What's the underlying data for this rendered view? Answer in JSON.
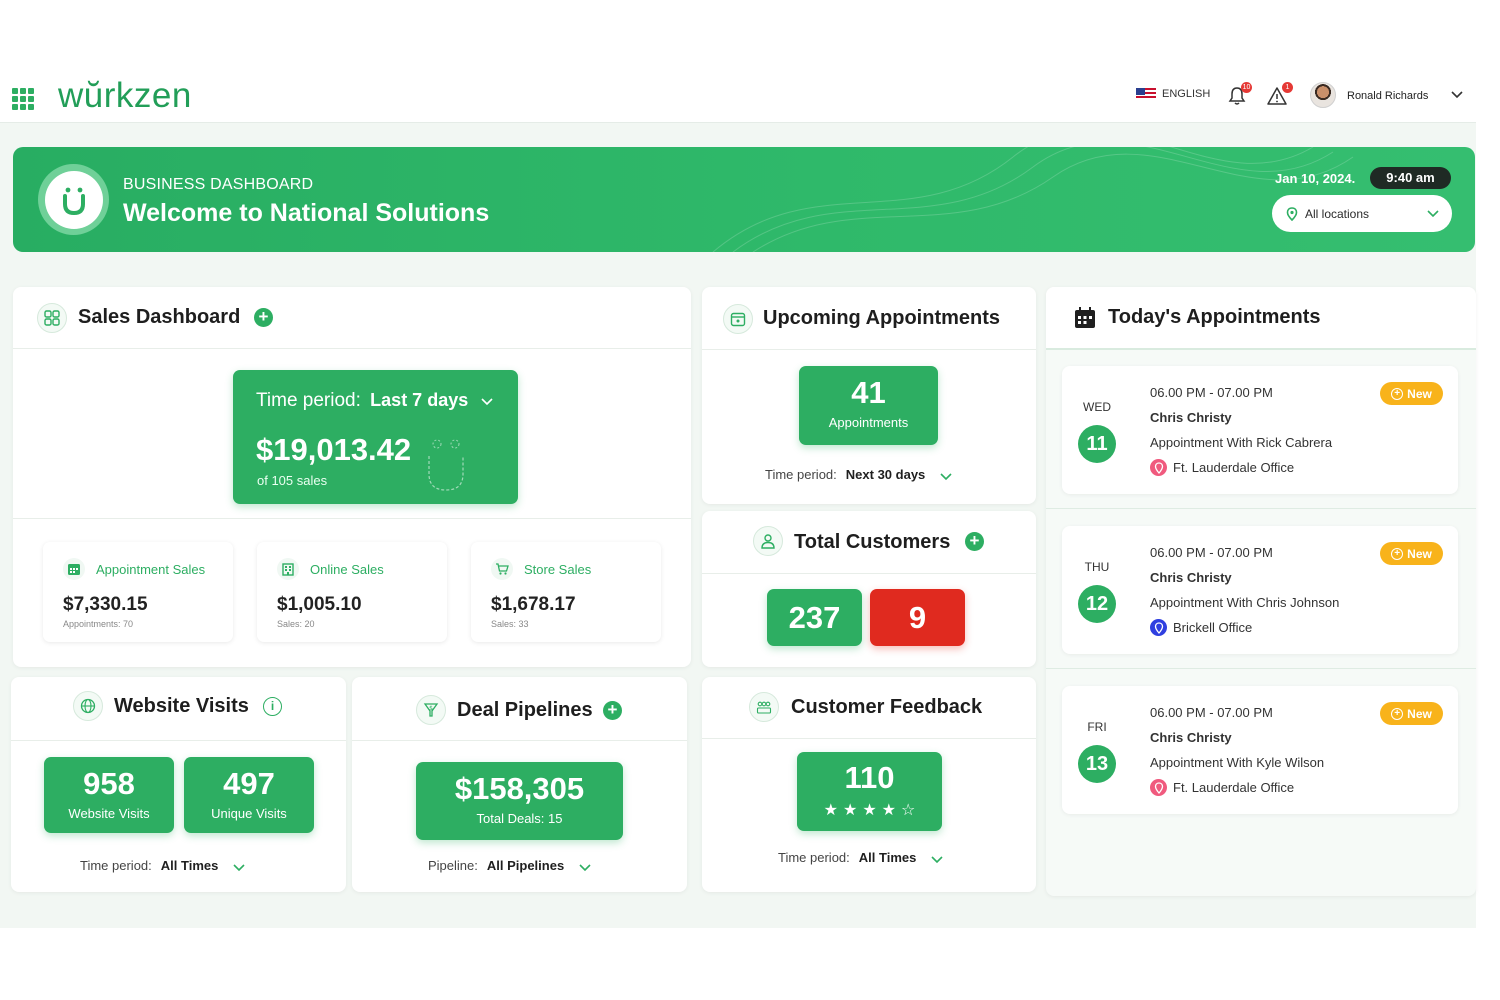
{
  "header": {
    "logo_text": "wŭrkzen",
    "language": "ENGLISH",
    "notifications_count": "10",
    "alerts_count": "1",
    "user_name": "Ronald Richards"
  },
  "banner": {
    "subtitle": "BUSINESS DASHBOARD",
    "title": "Welcome to National Solutions",
    "date": "Jan 10, 2024.",
    "time": "9:40 am",
    "location_select": "All locations"
  },
  "sales_dashboard": {
    "title": "Sales Dashboard",
    "period_label": "Time period:",
    "period_value": "Last 7 days",
    "total": "$19,013.42",
    "total_sub": "of 105 sales",
    "tiles": [
      {
        "label": "Appointment Sales",
        "value": "$7,330.15",
        "sub": "Appointments: 70"
      },
      {
        "label": "Online Sales",
        "value": "$1,005.10",
        "sub": "Sales: 20"
      },
      {
        "label": "Store Sales",
        "value": "$1,678.17",
        "sub": "Sales: 33"
      }
    ]
  },
  "upcoming": {
    "title": "Upcoming Appointments",
    "count": "41",
    "count_label": "Appointments",
    "period_label": "Time period:",
    "period_value": "Next 30 days"
  },
  "customers": {
    "title": "Total Customers",
    "total": "237",
    "flagged": "9",
    "flagged_color": "#e02a1f"
  },
  "website": {
    "title": "Website Visits",
    "visits": "958",
    "visits_label": "Website Visits",
    "unique": "497",
    "unique_label": "Unique Visits",
    "period_label": "Time period:",
    "period_value": "All Times"
  },
  "deals": {
    "title": "Deal Pipelines",
    "amount": "$158,305",
    "sub": "Total Deals: 15",
    "pipeline_label": "Pipeline:",
    "pipeline_value": "All Pipelines"
  },
  "feedback": {
    "title": "Customer Feedback",
    "count": "110",
    "rating_stars": 4,
    "rating_max": 5,
    "period_label": "Time period:",
    "period_value": "All Times"
  },
  "today": {
    "title": "Today's Appointments",
    "badge_label": "New",
    "items": [
      {
        "day": "WED",
        "date": "11",
        "time": "06.00 PM - 07.00 PM",
        "who": "Chris Christy",
        "desc": "Appointment With Rick Cabrera",
        "location": "Ft. Lauderdale Office",
        "pin_color": "#f05a7e"
      },
      {
        "day": "THU",
        "date": "12",
        "time": "06.00 PM - 07.00 PM",
        "who": "Chris Christy",
        "desc": "Appointment With Chris Johnson",
        "location": "Brickell Office",
        "pin_color": "#2f3fe0"
      },
      {
        "day": "FRI",
        "date": "13",
        "time": "06.00 PM - 07.00 PM",
        "who": "Chris Christy",
        "desc": "Appointment With Kyle Wilson",
        "location": "Ft. Lauderdale Office",
        "pin_color": "#f05a7e"
      }
    ]
  },
  "colors": {
    "accent": "#2dae62",
    "badge": "#f8b31b"
  }
}
